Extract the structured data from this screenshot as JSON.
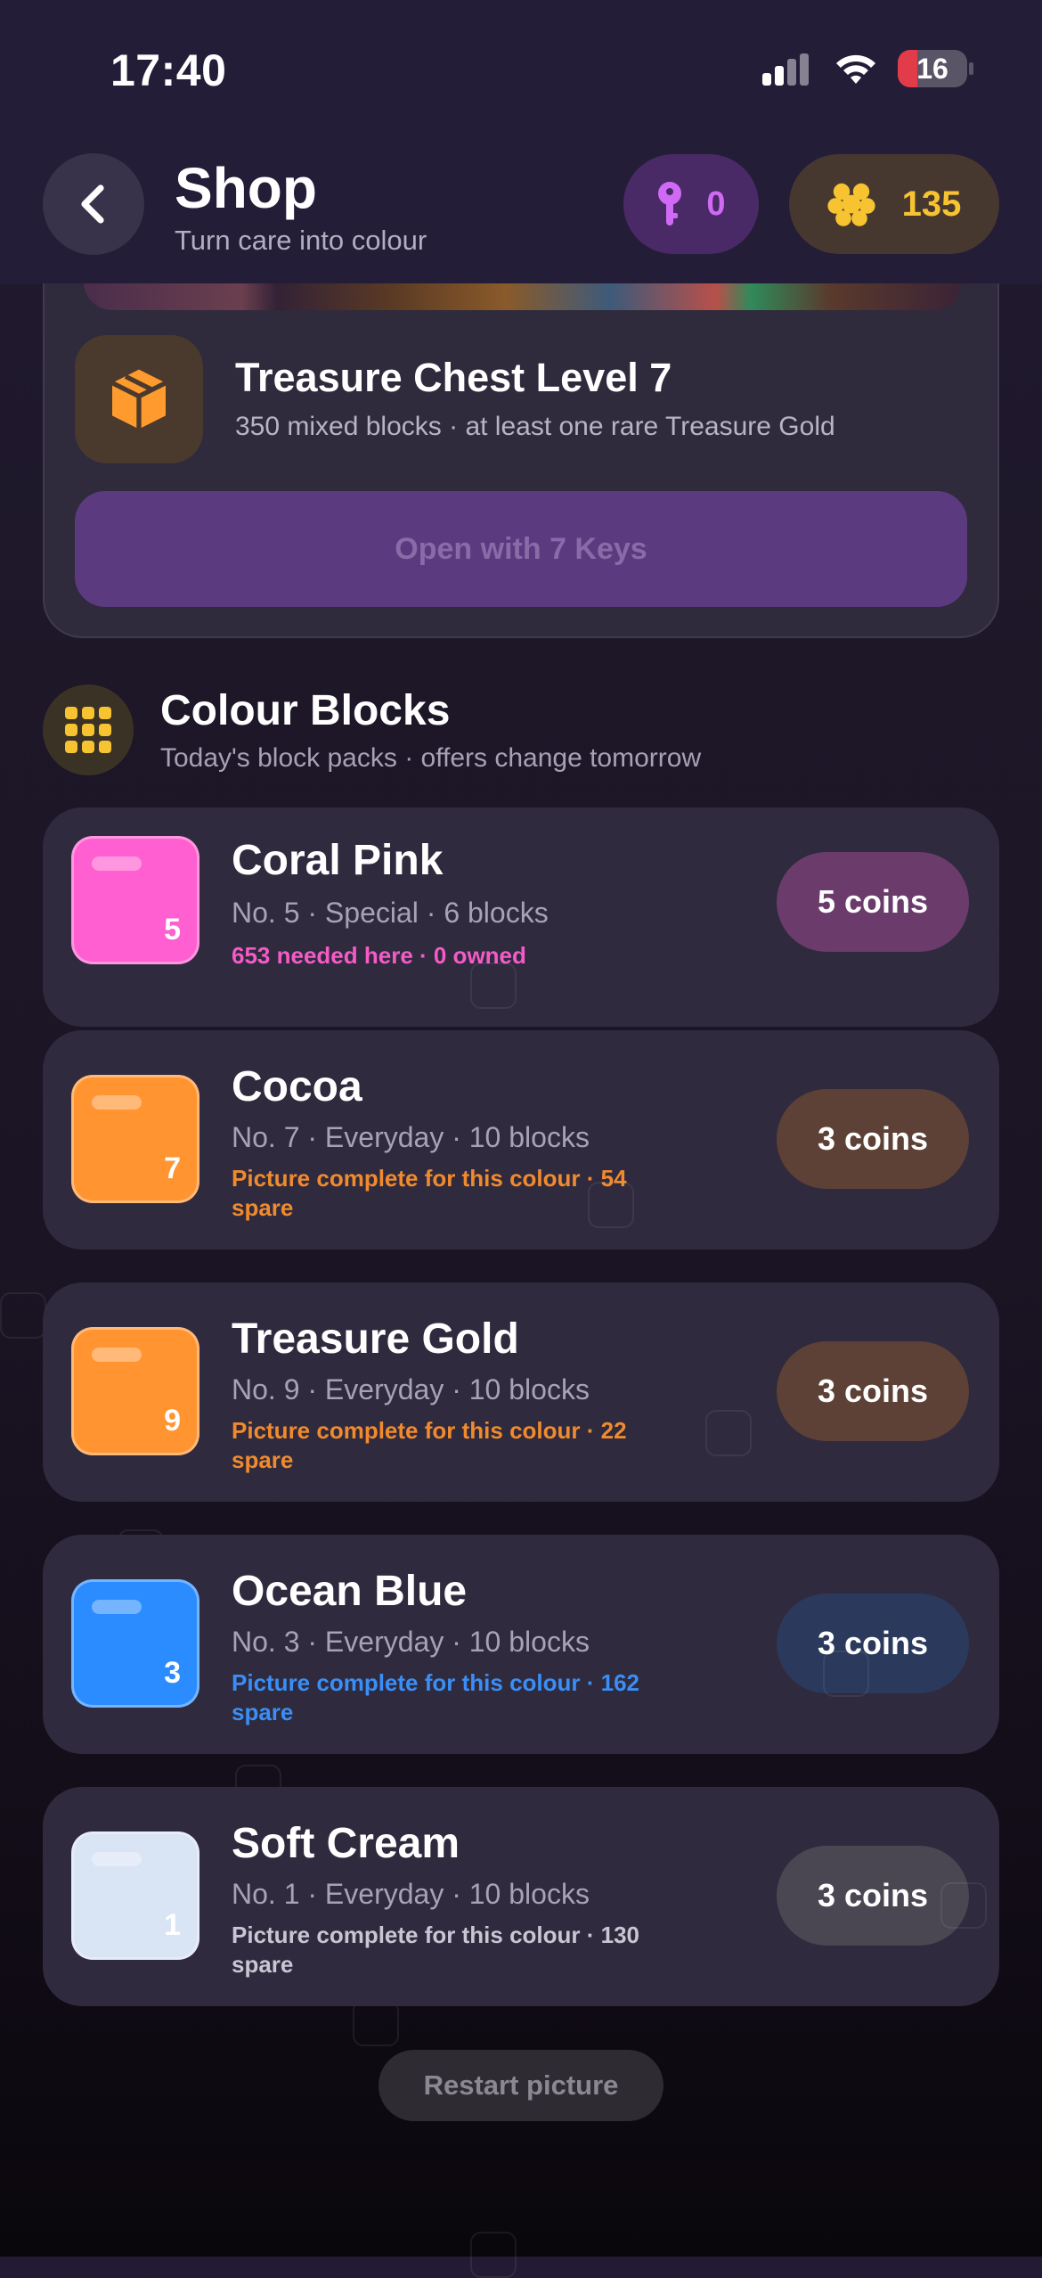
{
  "status": {
    "time": "17:40",
    "battery": "16"
  },
  "header": {
    "title": "Shop",
    "subtitle": "Turn care into colour",
    "keys": "0",
    "coins": "135"
  },
  "chest": {
    "title": "Treasure Chest Level 7",
    "subtitle": "350 mixed blocks · at least one rare Treasure Gold",
    "button": "Open with 7 Keys"
  },
  "section": {
    "title": "Colour Blocks",
    "subtitle": "Today's block packs · offers change tomorrow"
  },
  "blocks": [
    {
      "name": "Coral Pink",
      "number": "5",
      "meta": "No. 5 · Special · 6 blocks",
      "note": "653 needed here · 0 owned",
      "price": "5 coins",
      "color": "#ff5fd0",
      "note_color": "#f45bc7",
      "price_bg": "#6b3c6b"
    },
    {
      "name": "Cocoa",
      "number": "7",
      "meta": "No. 7 · Everyday · 10 blocks",
      "note": "Picture complete for this colour · 54 spare",
      "price": "3 coins",
      "color": "#ff9430",
      "note_color": "#f08a2e",
      "price_bg": "#5d4036"
    },
    {
      "name": "Treasure Gold",
      "number": "9",
      "meta": "No. 9 · Everyday · 10 blocks",
      "note": "Picture complete for this colour · 22 spare",
      "price": "3 coins",
      "color": "#ff9430",
      "note_color": "#f08a2e",
      "price_bg": "#5d4036"
    },
    {
      "name": "Ocean Blue",
      "number": "3",
      "meta": "No. 3 · Everyday · 10 blocks",
      "note": "Picture complete for this colour · 162 spare",
      "price": "3 coins",
      "color": "#2b8cff",
      "note_color": "#3a8ef5",
      "price_bg": "#2b3a5c"
    },
    {
      "name": "Soft Cream",
      "number": "1",
      "meta": "No. 1 · Everyday · 10 blocks",
      "note": "Picture complete for this colour · 130 spare",
      "price": "3 coins",
      "color": "#d9e4f5",
      "note_color": "#c9c5d3",
      "price_bg": "#4a4752"
    }
  ],
  "footer": {
    "restart": "Restart picture"
  },
  "icons": [
    "chevron-left-icon",
    "key-icon",
    "coins-icon",
    "package-icon",
    "grid-icon"
  ]
}
